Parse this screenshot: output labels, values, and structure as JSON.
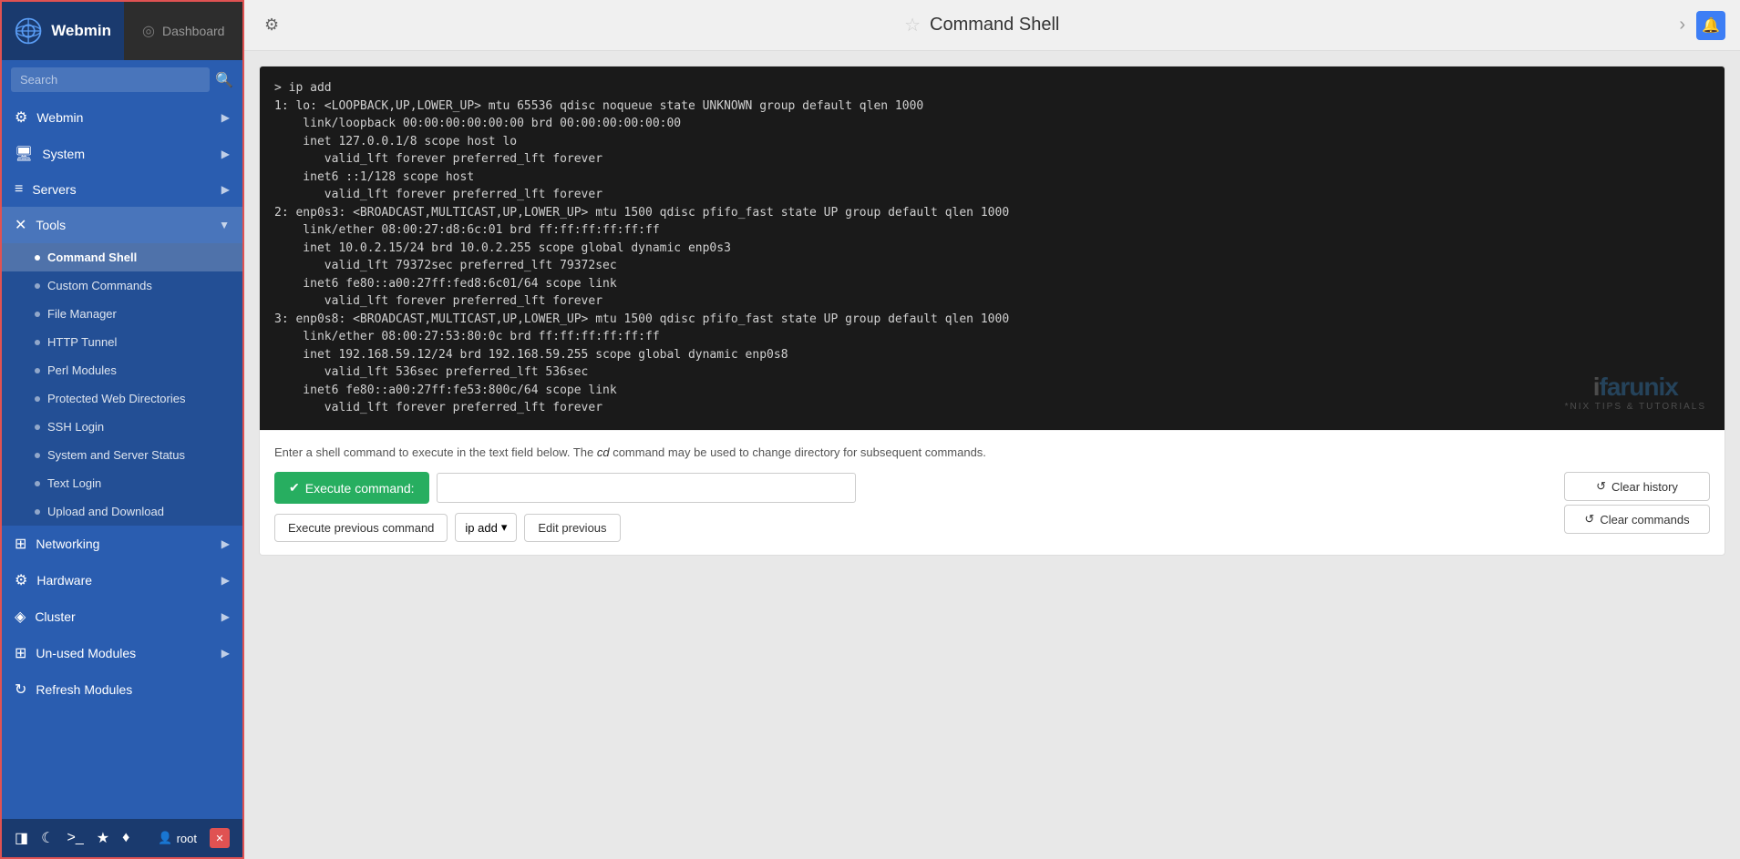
{
  "sidebar": {
    "title": "Webmin",
    "dashboard_tab": "Dashboard",
    "search_placeholder": "Search",
    "nav_items": [
      {
        "id": "webmin",
        "label": "Webmin",
        "icon": "⚙",
        "has_arrow": true
      },
      {
        "id": "system",
        "label": "System",
        "icon": "🖥",
        "has_arrow": true
      },
      {
        "id": "servers",
        "label": "Servers",
        "icon": "≡",
        "has_arrow": true
      },
      {
        "id": "tools",
        "label": "Tools",
        "icon": "✕",
        "active": true,
        "has_arrow": true,
        "sub_items": [
          {
            "id": "command-shell",
            "label": "Command Shell",
            "active": true
          },
          {
            "id": "custom-commands",
            "label": "Custom Commands"
          },
          {
            "id": "file-manager",
            "label": "File Manager"
          },
          {
            "id": "http-tunnel",
            "label": "HTTP Tunnel"
          },
          {
            "id": "perl-modules",
            "label": "Perl Modules"
          },
          {
            "id": "protected-web",
            "label": "Protected Web Directories"
          },
          {
            "id": "ssh-login",
            "label": "SSH Login"
          },
          {
            "id": "system-server-status",
            "label": "System and Server Status"
          },
          {
            "id": "text-login",
            "label": "Text Login"
          },
          {
            "id": "upload-download",
            "label": "Upload and Download"
          }
        ]
      },
      {
        "id": "networking",
        "label": "Networking",
        "icon": "⊞",
        "has_arrow": true
      },
      {
        "id": "hardware",
        "label": "Hardware",
        "icon": "⚙",
        "has_arrow": true
      },
      {
        "id": "cluster",
        "label": "Cluster",
        "icon": "◈",
        "has_arrow": true
      },
      {
        "id": "unused-modules",
        "label": "Un-used Modules",
        "icon": "⊞",
        "has_arrow": true
      },
      {
        "id": "refresh-modules",
        "label": "Refresh Modules",
        "icon": "↻"
      }
    ],
    "footer": {
      "icons": [
        "◨",
        "☾",
        ">_",
        "★",
        "♦"
      ],
      "user": "root"
    }
  },
  "topbar": {
    "page_title": "Command Shell",
    "gear_label": "⚙",
    "star_label": "☆",
    "close_label": "›",
    "notification_icon": "🔔"
  },
  "terminal": {
    "output": "> ip add\n1: lo: <LOOPBACK,UP,LOWER_UP> mtu 65536 qdisc noqueue state UNKNOWN group default qlen 1000\n    link/loopback 00:00:00:00:00:00 brd 00:00:00:00:00:00\n    inet 127.0.0.1/8 scope host lo\n       valid_lft forever preferred_lft forever\n    inet6 ::1/128 scope host\n       valid_lft forever preferred_lft forever\n2: enp0s3: <BROADCAST,MULTICAST,UP,LOWER_UP> mtu 1500 qdisc pfifo_fast state UP group default qlen 1000\n    link/ether 08:00:27:d8:6c:01 brd ff:ff:ff:ff:ff:ff\n    inet 10.0.2.15/24 brd 10.0.2.255 scope global dynamic enp0s3\n       valid_lft 79372sec preferred_lft 79372sec\n    inet6 fe80::a00:27ff:fed8:6c01/64 scope link\n       valid_lft forever preferred_lft forever\n3: enp0s8: <BROADCAST,MULTICAST,UP,LOWER_UP> mtu 1500 qdisc pfifo_fast state UP group default qlen 1000\n    link/ether 08:00:27:53:80:0c brd ff:ff:ff:ff:ff:ff\n    inet 192.168.59.12/24 brd 192.168.59.255 scope global dynamic enp0s8\n       valid_lft 536sec preferred_lft 536sec\n    inet6 fe80::a00:27ff:fe53:800c/64 scope link\n       valid_lft forever preferred_lft forever"
  },
  "controls": {
    "description_before": "Enter a shell command to execute in the text field below. The ",
    "description_cmd": "cd",
    "description_after": " command may be used to change directory for subsequent commands.",
    "execute_btn": "Execute command:",
    "exec_check": "✔",
    "execute_prev_btn": "Execute previous command",
    "prev_command_value": "ip add",
    "prev_dropdown_arrow": "▾",
    "edit_prev_btn": "Edit previous",
    "clear_history_btn": "Clear history",
    "clear_history_icon": "↺",
    "clear_commands_btn": "Clear commands",
    "clear_commands_icon": "↺"
  },
  "watermark": {
    "logo": "ifarunix",
    "sub": "*NIX TIPS & TUTORIALS"
  }
}
